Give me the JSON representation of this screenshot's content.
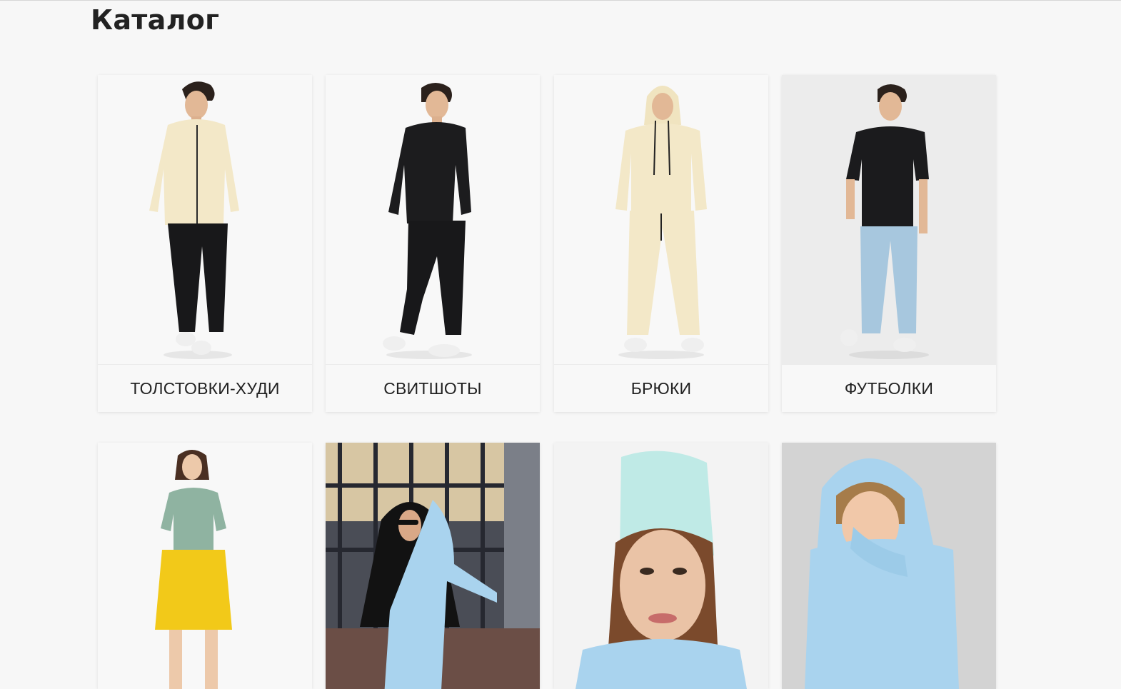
{
  "page": {
    "title": "Каталог"
  },
  "catalog": {
    "categories": [
      {
        "label": "ТОЛСТОВКИ-ХУДИ",
        "photo": "man-in-cream-zip-hoodie-and-black-joggers"
      },
      {
        "label": "СВИТШОТЫ",
        "photo": "man-in-black-sweatshirt-and-black-joggers"
      },
      {
        "label": "БРЮКИ",
        "photo": "man-in-cream-hoodie-and-cream-sweatpants"
      },
      {
        "label": "ФУТБОЛКИ",
        "photo": "man-in-black-tshirt-and-light-jeans"
      },
      {
        "label": "",
        "photo": "woman-in-sage-tshirt-and-yellow-shorts"
      },
      {
        "label": "",
        "photo": "woman-with-sunglasses-in-light-blue-hoodie-street"
      },
      {
        "label": "",
        "photo": "woman-in-mint-beanie-and-blue-hoodie"
      },
      {
        "label": "",
        "photo": "girl-in-light-blue-hoodie"
      }
    ]
  },
  "colors": {
    "background": "#f7f7f7",
    "title": "#222222",
    "label_background": "#f8f8f8",
    "cream": "#f3e8c8",
    "black_garment": "#1c1c1e",
    "light_blue": "#a9d3ee",
    "mint": "#bfeae6",
    "yellow": "#f2c919"
  }
}
